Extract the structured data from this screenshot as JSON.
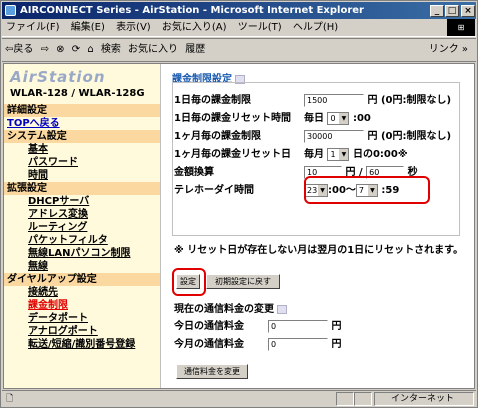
{
  "window": {
    "title": "AIRCONNECT Series - AirStation - Microsoft Internet Explorer",
    "controls": [
      "_",
      "□",
      "×"
    ]
  },
  "menu": [
    "ファイル(F)",
    "編集(E)",
    "表示(V)",
    "お気に入り(A)",
    "ツール(T)",
    "ヘルプ(H)"
  ],
  "toolbar": {
    "back": "⇦戻る",
    "forward": "⇨",
    "stop": "⊗",
    "refresh": "⟳",
    "home": "⌂",
    "search": "検索",
    "favorites": "お気に入り",
    "history": "履歴",
    "links": "リンク »"
  },
  "sidebar": {
    "brand": "AirStation",
    "model": "WLAR-128 / WLAR-128G",
    "items": [
      {
        "label": "詳細設定",
        "type": "hd"
      },
      {
        "label": "TOPへ戻る",
        "type": "top"
      },
      {
        "label": "システム設定",
        "type": "hd"
      },
      {
        "label": "基本",
        "type": "it"
      },
      {
        "label": "パスワード",
        "type": "it"
      },
      {
        "label": "時間",
        "type": "it"
      },
      {
        "label": "拡張設定",
        "type": "hd"
      },
      {
        "label": "DHCPサーバ",
        "type": "it"
      },
      {
        "label": "アドレス変換",
        "type": "it"
      },
      {
        "label": "ルーティング",
        "type": "it"
      },
      {
        "label": "パケットフィルタ",
        "type": "it"
      },
      {
        "label": "無線LANパソコン制限",
        "type": "it"
      },
      {
        "label": "無線",
        "type": "it"
      },
      {
        "label": "ダイヤルアップ設定",
        "type": "hd"
      },
      {
        "label": "接続先",
        "type": "it"
      },
      {
        "label": "課金制限",
        "type": "it cur"
      },
      {
        "label": "データポート",
        "type": "it"
      },
      {
        "label": "アナログポート",
        "type": "it"
      },
      {
        "label": "転送/短縮/識別番号登録",
        "type": "it"
      }
    ]
  },
  "main": {
    "title": "課金制限設定",
    "daily_limit": {
      "label": "1日毎の課金制限",
      "value": "1500",
      "suffix": "円 (0円:制限なし)"
    },
    "daily_reset": {
      "label": "1日毎の課金リセット時間",
      "prefix": "毎日",
      "value": "0",
      "suffix": ":00"
    },
    "monthly_limit": {
      "label": "1ヶ月毎の課金制限",
      "value": "30000",
      "suffix": "円 (0円:制限なし)"
    },
    "monthly_reset": {
      "label": "1ヶ月毎の課金リセット日",
      "prefix": "毎月",
      "value": "1",
      "suffix": "日の0:00※"
    },
    "conversion": {
      "label": "金額換算",
      "value1": "10",
      "mid": "円 /",
      "value2": "60",
      "suffix": "秒"
    },
    "telehodai": {
      "label": "テレホーダイ時間",
      "start": "23",
      "mid": ":00〜",
      "end": "7",
      "suffix": ":59"
    },
    "note": "※ リセット日が存在しない月は翌月の1日にリセットされます。",
    "set_button": "設定",
    "reset_button": "初期設定に戻す",
    "current_title": "現在の通信料金の変更",
    "today": {
      "label": "今日の通信料金",
      "value": "0",
      "suffix": "円"
    },
    "month": {
      "label": "今月の通信料金",
      "value": "0",
      "suffix": "円"
    },
    "change_button": "通信料金を変更"
  },
  "status": {
    "zone": "インターネット"
  }
}
